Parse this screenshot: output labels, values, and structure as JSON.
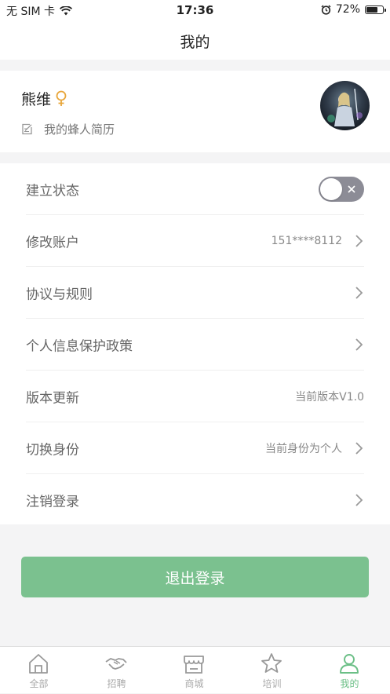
{
  "status_bar": {
    "carrier": "无 SIM 卡",
    "time": "17:36",
    "battery_percent": "72%",
    "battery_level": 0.72
  },
  "nav": {
    "title": "我的"
  },
  "profile": {
    "name": "熊维",
    "resume_label": "我的蜂人简历"
  },
  "settings": [
    {
      "label": "建立状态",
      "value": "",
      "control": "toggle",
      "toggle_on": false
    },
    {
      "label": "修改账户",
      "value": "151****8112",
      "control": "chevron"
    },
    {
      "label": "协议与规则",
      "value": "",
      "control": "chevron"
    },
    {
      "label": "个人信息保护政策",
      "value": "",
      "control": "chevron"
    },
    {
      "label": "版本更新",
      "value": "当前版本V1.0",
      "control": "none"
    },
    {
      "label": "切换身份",
      "value": "当前身份为个人",
      "control": "chevron"
    },
    {
      "label": "注销登录",
      "value": "",
      "control": "chevron"
    }
  ],
  "logout_button": "退出登录",
  "tabs": [
    {
      "label": "全部",
      "icon": "home-icon",
      "active": false
    },
    {
      "label": "招聘",
      "icon": "handshake-icon",
      "active": false
    },
    {
      "label": "商城",
      "icon": "store-icon",
      "active": false
    },
    {
      "label": "培训",
      "icon": "star-icon",
      "active": false
    },
    {
      "label": "我的",
      "icon": "user-icon",
      "active": true
    }
  ],
  "colors": {
    "accent": "#7bc18f",
    "active_tab": "#6bbf86",
    "toggle_off": "#8c8c96",
    "female_symbol": "#e8a63a"
  }
}
